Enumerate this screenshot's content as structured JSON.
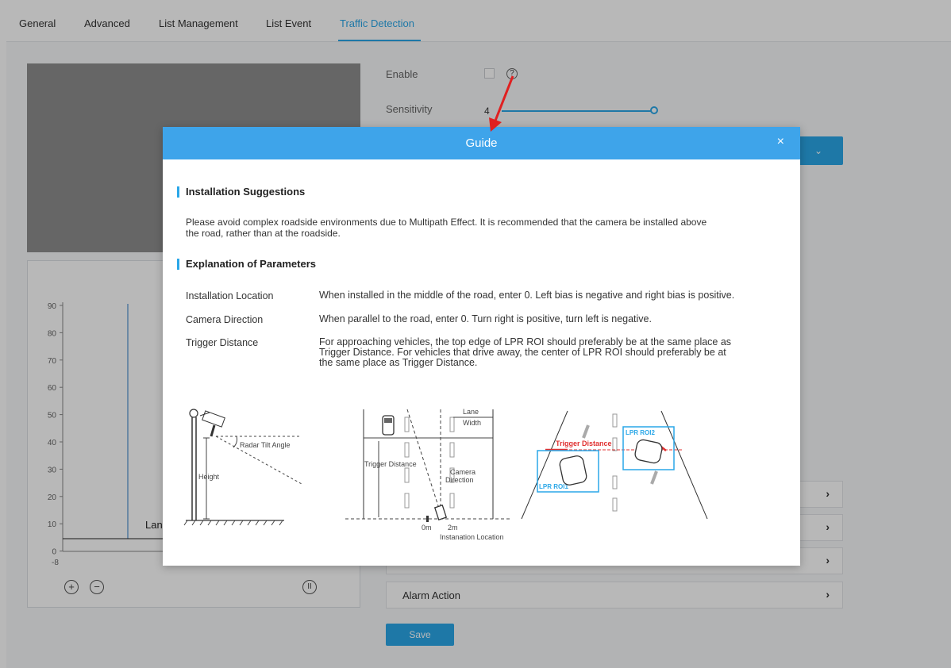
{
  "tabs": [
    {
      "label": "General"
    },
    {
      "label": "Advanced"
    },
    {
      "label": "List Management"
    },
    {
      "label": "List Event"
    },
    {
      "label": "Traffic Detection"
    }
  ],
  "settings": {
    "enable_label": "Enable",
    "sensitivity_label": "Sensitivity",
    "sensitivity_value": "4",
    "help_glyph": "?"
  },
  "accordion": {
    "alarm_action_label": "Alarm Action"
  },
  "save_label": "Save",
  "radar_chart": {
    "y_ticks": [
      "90",
      "80",
      "70",
      "60",
      "50",
      "40",
      "30",
      "20",
      "10",
      "0"
    ],
    "x_start": "-8",
    "lane_label_partial": "Lan"
  },
  "guide": {
    "title": "Guide",
    "close": "×",
    "install_title": "Installation Suggestions",
    "install_line1": "Please avoid complex roadside environments due to Multipath Effect. It is recommended that the camera be installed above",
    "install_line2": "the road, rather than at the roadside.",
    "params_title": "Explanation of Parameters",
    "params": [
      {
        "name": "Installation Location",
        "desc": [
          "When installed in the middle of the road, enter 0. Left bias is negative and right bias is positive."
        ]
      },
      {
        "name": "Camera Direction",
        "desc": [
          "When parallel to the road, enter 0. Turn right is positive, turn left is negative."
        ]
      },
      {
        "name": "Trigger Distance",
        "desc": [
          "For approaching vehicles, the top edge of LPR ROI should preferably be at the same place as",
          "Trigger Distance. For vehicles that drive away, the center of LPR ROI should preferably be at",
          "the same place as Trigger Distance."
        ]
      }
    ],
    "diagram1": {
      "tilt": "Radar Tilt Angle",
      "height": "Height"
    },
    "diagram2": {
      "lane": "Lane",
      "width": "Width",
      "trigger": "Trigger Distance",
      "camera": "Camera",
      "direction": "Direction",
      "zero": "0m",
      "two": "2m",
      "install_loc": "Instanation Location"
    },
    "diagram3": {
      "trigger": "Trigger Distance",
      "roi1": "LPR ROI1",
      "roi2": "LPR ROI2"
    }
  }
}
